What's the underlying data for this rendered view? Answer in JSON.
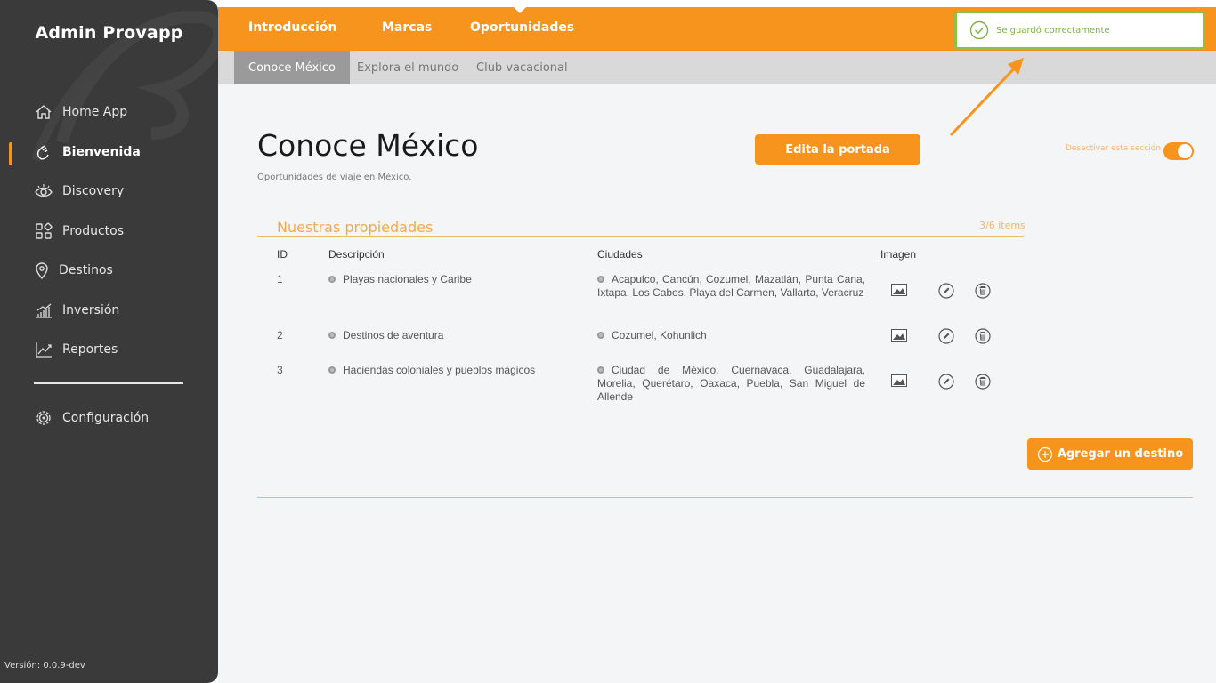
{
  "sidebar": {
    "app_title": "Admin Provapp",
    "items": [
      {
        "label": "Home App",
        "icon": "home-icon"
      },
      {
        "label": "Bienvenida",
        "icon": "waving-hand-icon"
      },
      {
        "label": "Discovery",
        "icon": "eye-icon"
      },
      {
        "label": "Productos",
        "icon": "grid-icon"
      },
      {
        "label": "Destinos",
        "icon": "map-pin-icon"
      },
      {
        "label": "Inversión",
        "icon": "bar-chart-icon"
      },
      {
        "label": "Reportes",
        "icon": "line-chart-icon"
      }
    ],
    "settings_label": "Configuración",
    "version": "Versión: 0.0.9-dev",
    "active_item": "Bienvenida"
  },
  "topbar": {
    "tabs": [
      "Introducción",
      "Marcas",
      "Oportunidades"
    ],
    "active_tab": "Oportunidades"
  },
  "subtabs": {
    "items": [
      "Conoce México",
      "Explora el mundo",
      "Club vacacional"
    ],
    "active": "Conoce México"
  },
  "page": {
    "title": "Conoce México",
    "subtitle": "Oportunidades de viaje en México.",
    "edit_cover_button": "Edita la portada",
    "toggle_label": "Desactivar esta sección",
    "toggle_on": true
  },
  "section": {
    "title": "Nuestras propiedades",
    "count": "3/6 items",
    "columns": [
      "ID",
      "Descripción",
      "Ciudades",
      "Imagen"
    ],
    "rows": [
      {
        "id": "1",
        "description": "Playas nacionales y Caribe",
        "cities": "Acapulco, Cancún, Cozumel, Mazatlán, Punta Cana, Ixtapa, Los Cabos, Playa del Carmen, Vallarta, Veracruz"
      },
      {
        "id": "2",
        "description": "Destinos de aventura",
        "cities": "Cozumel, Kohunlich"
      },
      {
        "id": "3",
        "description": "Haciendas coloniales y pueblos mágicos",
        "cities": "Ciudad de México, Cuernavaca, Guadalajara, Morelia, Querétaro, Oaxaca, Puebla, San Miguel de Allende"
      }
    ],
    "add_button": "Agregar un destino"
  },
  "toast": {
    "message": "Se guardó correctamente"
  },
  "colors": {
    "accent": "#f7941d",
    "sidebar_bg": "#3a3a3a",
    "success": "#8bc34a"
  }
}
